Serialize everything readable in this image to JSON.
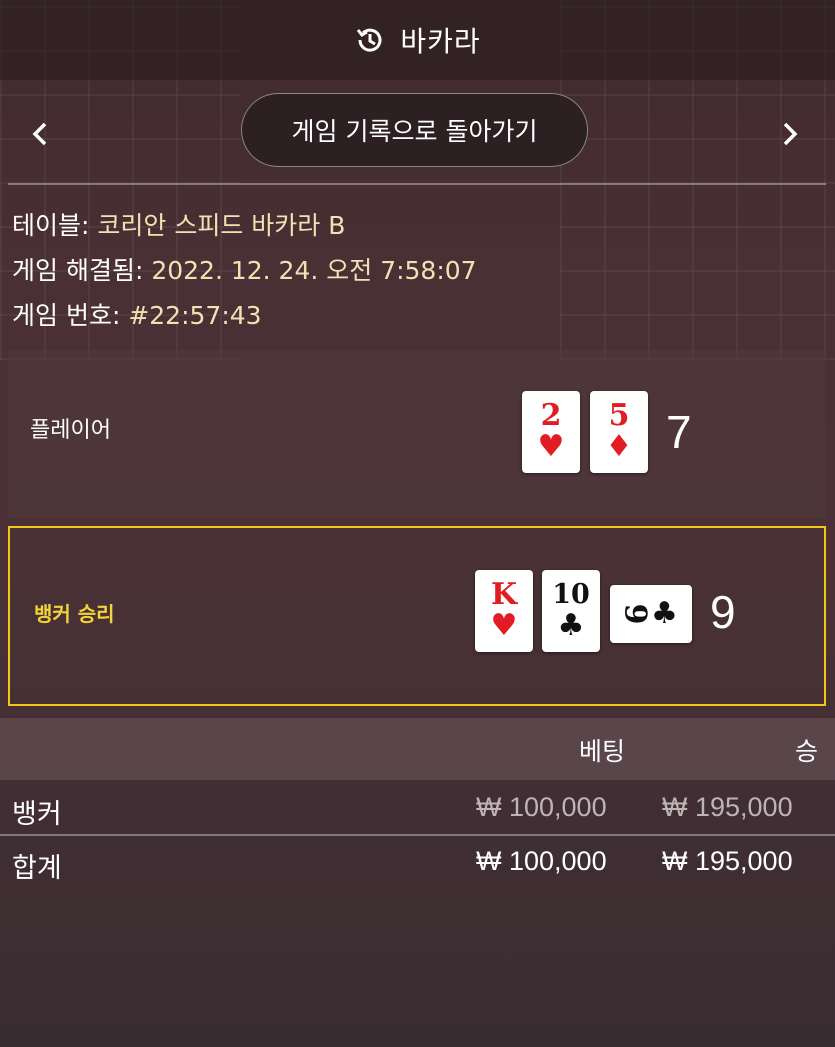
{
  "header": {
    "title": "바카라",
    "icon": "history-icon"
  },
  "nav": {
    "back_label": "게임 기록으로 돌아가기"
  },
  "info": {
    "table_label": "테이블:",
    "table_value": "코리안 스피드 바카라 B",
    "resolved_label": "게임 해결됨:",
    "resolved_value": "2022. 12. 24. 오전 7:58:07",
    "number_label": "게임 번호:",
    "number_value": "#22:57:43"
  },
  "player": {
    "label": "플레이어",
    "cards": [
      {
        "rank": "2",
        "suit": "♥"
      },
      {
        "rank": "5",
        "suit": "♦"
      }
    ],
    "score": "7"
  },
  "banker": {
    "label": "뱅커 승리",
    "cards": [
      {
        "rank": "K",
        "suit": "♥"
      },
      {
        "rank": "10",
        "suit": "♣"
      },
      {
        "rank": "9",
        "suit": "♣"
      }
    ],
    "score": "9"
  },
  "table": {
    "headers": {
      "bet": "베팅",
      "win": "승"
    },
    "rows": [
      {
        "label": "뱅커",
        "bet": "₩ 100,000",
        "win": "₩ 195,000"
      },
      {
        "label": "합계",
        "bet": "₩ 100,000",
        "win": "₩ 195,000"
      }
    ]
  },
  "colors": {
    "accent": "#f2c71b",
    "card_red": "#e21c23"
  }
}
